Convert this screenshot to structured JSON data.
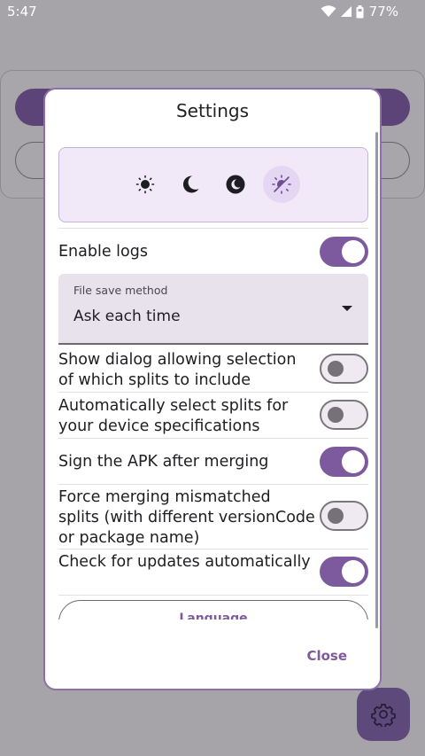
{
  "status_bar": {
    "time": "5:47",
    "battery_percent": "77%",
    "icons": [
      "wifi-icon",
      "signal-icon",
      "battery-icon"
    ]
  },
  "dialog": {
    "title": "Settings",
    "theme_options": [
      {
        "icon": "sun-icon",
        "selected": false
      },
      {
        "icon": "moon-icon",
        "selected": false
      },
      {
        "icon": "moon-circle-icon",
        "selected": false
      },
      {
        "icon": "auto-brightness-icon",
        "selected": true
      }
    ],
    "enable_logs": {
      "label": "Enable logs",
      "on": true
    },
    "file_save_method": {
      "label": "File save method",
      "value": "Ask each time"
    },
    "settings": [
      {
        "label": "Show dialog allowing selection of which splits to include",
        "on": false
      },
      {
        "label": "Automatically select splits for your device specifications",
        "on": false
      },
      {
        "label": "Sign the APK after merging",
        "on": true
      },
      {
        "label": "Force merging mismatched splits (with different versionCode or package name)",
        "on": false
      },
      {
        "label": "Check for updates automatically",
        "on": true
      }
    ],
    "language_button": "Language",
    "close_button": "Close"
  },
  "colors": {
    "accent": "#7d5a9e",
    "dialog_border": "#8c6ea8",
    "theme_box_bg": "#f1e8f8",
    "scrim": "#a6a4a8"
  }
}
